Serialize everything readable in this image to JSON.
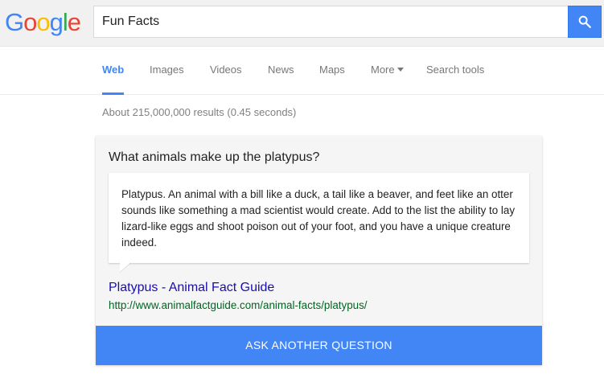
{
  "logo": {
    "letters": [
      "G",
      "o",
      "o",
      "g",
      "l",
      "e"
    ],
    "colors": [
      "#4285f4",
      "#ea4335",
      "#fbbc05",
      "#4285f4",
      "#34a853",
      "#ea4335"
    ]
  },
  "search": {
    "query": "Fun Facts",
    "button_icon": "search-icon",
    "button_color": "#4285f4"
  },
  "nav": {
    "items": [
      {
        "label": "Web",
        "active": true
      },
      {
        "label": "Images",
        "active": false
      },
      {
        "label": "Videos",
        "active": false
      },
      {
        "label": "News",
        "active": false
      },
      {
        "label": "Maps",
        "active": false
      },
      {
        "label": "More",
        "active": false,
        "icon": "caret-down-icon"
      },
      {
        "label": "Search tools",
        "active": false
      }
    ]
  },
  "result_stats": "About 215,000,000 results (0.45 seconds)",
  "card": {
    "question": "What animals make up the platypus?",
    "answer": "Platypus. An animal with a bill like a duck, a tail like a beaver, and feet like an otter sounds like something a mad scientist would create. Add to the list the ability to lay lizard-like eggs and shoot poison out of your foot, and you have a unique creature indeed.",
    "source_title": "Platypus - Animal Fact Guide",
    "source_url": "http://www.animalfactguide.com/animal-facts/platypus/",
    "button_label": "ASK ANOTHER QUESTION",
    "button_color": "#4285f4"
  }
}
